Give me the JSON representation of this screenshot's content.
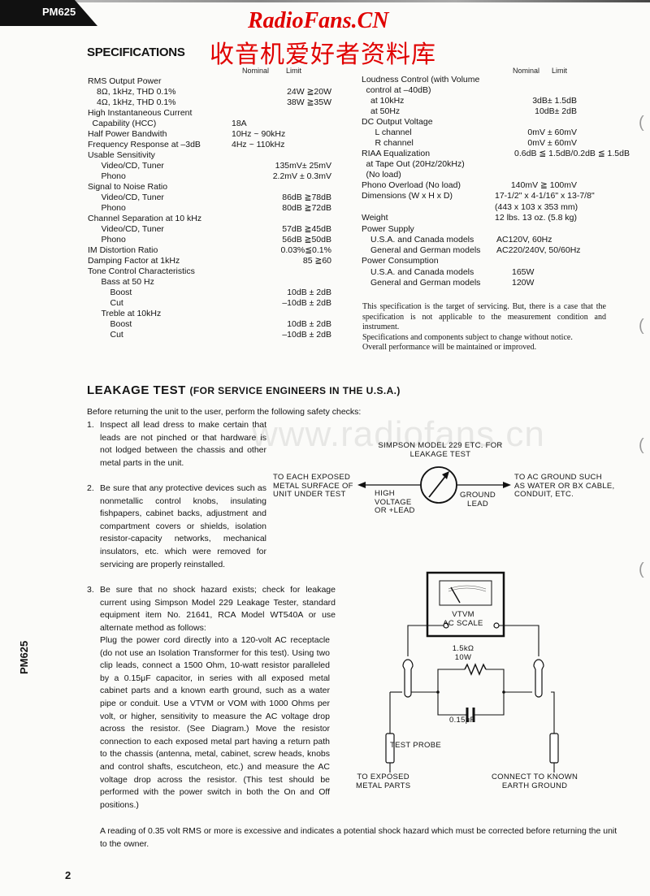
{
  "header": {
    "model": "PM625",
    "watermark_title": "RadioFans.CN",
    "watermark_chinese": "收音机爱好者资料库",
    "watermark_url": "www.radiofans.cn",
    "watermark_color": "#e00000"
  },
  "specifications": {
    "title": "SPECIFICATIONS",
    "col_nominal": "Nominal",
    "col_limit": "Limit",
    "left": [
      {
        "label": "RMS Output Power",
        "value": "",
        "indent": 0
      },
      {
        "label": "8Ω, 1kHz, THD 0.1%",
        "value": "24W ≧20W",
        "indent": 1
      },
      {
        "label": "4Ω, 1kHz, THD 0.1%",
        "value": "38W ≧35W",
        "indent": 1
      },
      {
        "label": "High Instantaneous Current",
        "value": "",
        "indent": 0
      },
      {
        "label": "Capability (HCC)",
        "value": "18A",
        "indent": 0.5,
        "align": "left"
      },
      {
        "label": "Half Power Bandwith",
        "value": "10Hz ~ 90kHz",
        "indent": 0,
        "align": "left"
      },
      {
        "label": "Frequency Response at –3dB",
        "value": "4Hz ~ 110kHz",
        "indent": 0,
        "align": "left"
      },
      {
        "label": "Usable Sensitivity",
        "value": "",
        "indent": 0
      },
      {
        "label": "Video/CD, Tuner",
        "value": "135mV± 25mV",
        "indent": 1.5
      },
      {
        "label": "Phono",
        "value": "2.2mV ± 0.3mV",
        "indent": 1.5
      },
      {
        "label": "Signal to Noise Ratio",
        "value": "",
        "indent": 0
      },
      {
        "label": "Video/CD, Tuner",
        "value": "86dB ≧78dB",
        "indent": 1.5
      },
      {
        "label": "Phono",
        "value": "80dB ≧72dB",
        "indent": 1.5
      },
      {
        "label": "Channel Separation at 10 kHz",
        "value": "",
        "indent": 0
      },
      {
        "label": "Video/CD, Tuner",
        "value": "57dB ≧45dB",
        "indent": 1.5
      },
      {
        "label": "Phono",
        "value": "56dB ≧50dB",
        "indent": 1.5
      },
      {
        "label": "IM Distortion Ratio",
        "value": "0.03%≦0.1%",
        "indent": 0
      },
      {
        "label": "Damping Factor at 1kHz",
        "value": "85  ≧60",
        "indent": 0
      },
      {
        "label": "Tone Control Characteristics",
        "value": "",
        "indent": 0
      },
      {
        "label": "Bass at 50 Hz",
        "value": "",
        "indent": 1.5
      },
      {
        "label": "Boost",
        "value": "10dB ± 2dB",
        "indent": 2.5
      },
      {
        "label": "Cut",
        "value": "–10dB ± 2dB",
        "indent": 2.5
      },
      {
        "label": "Treble at 10kHz",
        "value": "",
        "indent": 1.5
      },
      {
        "label": "Boost",
        "value": "10dB ± 2dB",
        "indent": 2.5
      },
      {
        "label": "Cut",
        "value": "–10dB ± 2dB",
        "indent": 2.5
      }
    ],
    "right": [
      {
        "label": "Loudness Control (with Volume",
        "value": "",
        "indent": 0
      },
      {
        "label": "control at –40dB)",
        "value": "",
        "indent": 0.5
      },
      {
        "label": "at 10kHz",
        "value": "3dB± 1.5dB",
        "indent": 1
      },
      {
        "label": "at 50Hz",
        "value": "10dB± 2dB",
        "indent": 1
      },
      {
        "label": "DC Output Voltage",
        "value": "",
        "indent": 0
      },
      {
        "label": "L channel",
        "value": "0mV ± 60mV",
        "indent": 1.5
      },
      {
        "label": "R channel",
        "value": "0mV ± 60mV",
        "indent": 1.5
      },
      {
        "label": "RIAA Equalization",
        "value": "0.6dB ≦ 1.5dB/0.2dB ≦ 1.5dB",
        "indent": 0,
        "align": "wide"
      },
      {
        "label": "at Tape Out (20Hz/20kHz)",
        "value": "",
        "indent": 0.5
      },
      {
        "label": "(No load)",
        "value": "",
        "indent": 0.5
      },
      {
        "label": "Phono Overload (No load)",
        "value": "140mV ≧ 100mV",
        "indent": 0
      },
      {
        "label": "Dimensions (W x H x D)",
        "value": "17-1/2\" x 4-1/16\" x 13-7/8\"",
        "indent": 0,
        "align": "left"
      },
      {
        "label": "",
        "value": "(443 x 103 x 353 mm)",
        "indent": 0,
        "align": "left"
      },
      {
        "label": "Weight",
        "value": "12 lbs. 13 oz. (5.8 kg)",
        "indent": 0,
        "align": "left"
      },
      {
        "label": "Power Supply",
        "value": "",
        "indent": 0
      },
      {
        "label": "U.S.A. and Canada models",
        "value": "AC120V, 60Hz",
        "indent": 1,
        "align": "close"
      },
      {
        "label": "General and German models",
        "value": "AC220/240V, 50/60Hz",
        "indent": 1,
        "align": "close"
      },
      {
        "label": "Power Consumption",
        "value": "",
        "indent": 0
      },
      {
        "label": "U.S.A. and Canada models",
        "value": "165W",
        "indent": 1,
        "align": "left"
      },
      {
        "label": "General and German models",
        "value": "120W",
        "indent": 1,
        "align": "left"
      }
    ],
    "note_lines": [
      "This specification is the target of servicing. But, there is a case that the specification is not applicable to the measurement condition and instrument.",
      "Specifications and components subject to change without notice.",
      "Overall performance will be maintained or improved."
    ]
  },
  "leakage_test": {
    "title": "LEAKAGE  TEST",
    "subtitle": "(FOR SERVICE ENGINEERS IN THE U.S.A.)",
    "intro": "Before returning the unit to the user, perform the following safety checks:",
    "items": [
      {
        "num": "1.",
        "text": "Inspect all lead dress to make certain that leads are not pinched or that hardware is not lodged between the chassis and other metal parts in the unit."
      },
      {
        "num": "2.",
        "text": "Be sure that any protective devices such as nonmetallic control knobs, insulating fishpapers, cabinet backs, adjustment and compartment covers or shields, isolation resistor-capacity networks, mechanical insulators, etc. which were removed for servicing are properly reinstalled."
      },
      {
        "num": "3.",
        "text": "Be sure that no shock hazard exists; check for leakage current using Simpson Model 229 Leakage Tester, standard equipment item No. 21641, RCA Model WT540A or use alternate method as follows:"
      }
    ],
    "procedure": "Plug the power cord directly into a 120-volt AC receptacle (do not use an Isolation Transformer for this test). Using two clip leads, connect a 1500 Ohm, 10-watt resistor paralleled by a 0.15μF capacitor, in series with all exposed metal cabinet parts and a known earth ground, such as a water pipe or conduit. Use a VTVM or VOM with 1000 Ohms per volt, or higher, sensitivity to measure the AC voltage drop across the resistor. (See Diagram.) Move the resistor connection to each exposed metal part having a return path to the chassis (antenna, metal, cabinet, screw heads, knobs and control shafts, escutcheon, etc.) and measure the AC voltage drop across the resistor. (This test should be performed with the power switch in both the On and Off positions.)",
    "conclusion": "A reading of 0.35 volt RMS or more  is  excessive  and indicates a potential shock hazard which must be corrected before returning the unit to the owner."
  },
  "diagram1": {
    "title_line1": "SIMPSON MODEL 229 ETC. FOR",
    "title_line2": "LEAKAGE TEST",
    "left_label": [
      "TO EACH EXPOSED",
      "METAL SURFACE OF",
      "UNIT UNDER TEST"
    ],
    "high_label": [
      "HIGH",
      "VOLTAGE",
      "OR +LEAD"
    ],
    "ground_label": [
      "GROUND",
      "LEAD"
    ],
    "right_label": [
      "TO AC GROUND SUCH",
      "AS WATER OR BX CABLE,",
      "CONDUIT, ETC."
    ]
  },
  "diagram2": {
    "meter_line1": "VTVM",
    "meter_line2": "AC SCALE",
    "resistor_value": "1.5kΩ",
    "resistor_power": "10W",
    "capacitor_value": "0.15μF",
    "probe_label": "TEST PROBE",
    "left_bottom": [
      "TO EXPOSED",
      "METAL PARTS"
    ],
    "right_bottom": [
      "CONNECT TO KNOWN",
      "EARTH GROUND"
    ]
  },
  "footer": {
    "page_number": "2",
    "side_model": "PM625"
  }
}
